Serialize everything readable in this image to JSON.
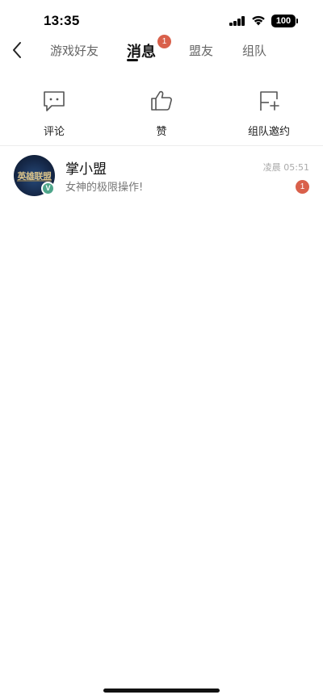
{
  "status_bar": {
    "time": "13:35",
    "battery": "100"
  },
  "nav": {
    "tabs": [
      {
        "label": "游戏好友",
        "active": false
      },
      {
        "label": "消息",
        "active": true,
        "badge": "1"
      },
      {
        "label": "盟友",
        "active": false
      },
      {
        "label": "组队",
        "active": false
      }
    ]
  },
  "actions": [
    {
      "label": "评论",
      "icon": "comment-icon"
    },
    {
      "label": "赞",
      "icon": "thumbs-up-icon"
    },
    {
      "label": "组队邀约",
      "icon": "flag-plus-icon"
    }
  ],
  "conversations": [
    {
      "name": "掌小盟",
      "message": "女神的极限操作!",
      "time": "凌晨 05:51",
      "unread": "1",
      "avatar_text": "英雄联盟",
      "verified_mark": "V"
    }
  ],
  "colors": {
    "badge": "#d9604b",
    "verified": "#4da58a"
  }
}
